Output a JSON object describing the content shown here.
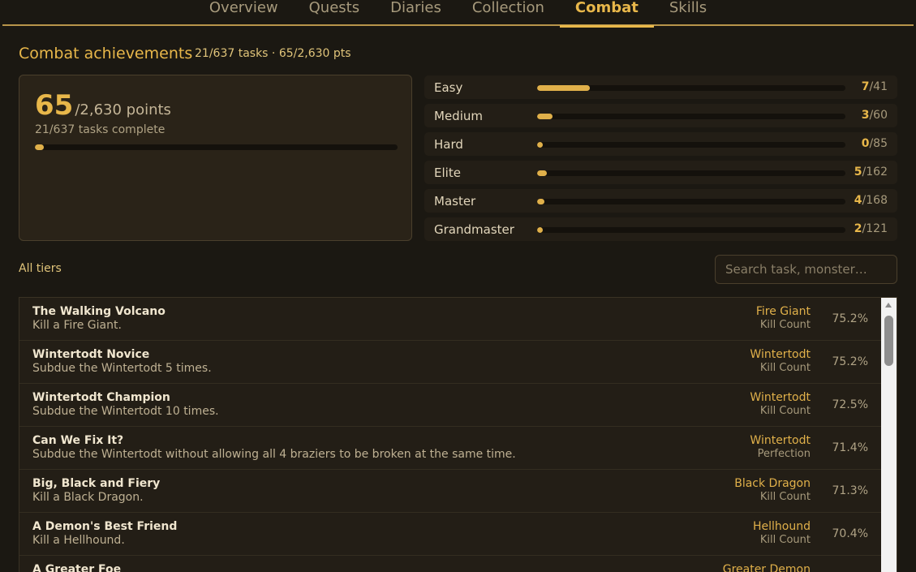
{
  "nav": {
    "tabs": [
      {
        "label": "Overview",
        "active": false
      },
      {
        "label": "Quests",
        "active": false
      },
      {
        "label": "Diaries",
        "active": false
      },
      {
        "label": "Collection",
        "active": false
      },
      {
        "label": "Combat",
        "active": true
      },
      {
        "label": "Skills",
        "active": false
      }
    ]
  },
  "header": {
    "title": "Combat achievements",
    "summary": "21/637 tasks · 65/2,630 pts"
  },
  "points": {
    "earned": "65",
    "total_label": "/2,630 points",
    "tasks_label": "21/637 tasks complete",
    "progress_fraction": 0.0247
  },
  "tiers": [
    {
      "name": "Easy",
      "done": "7",
      "total": "/41",
      "fraction": 0.171
    },
    {
      "name": "Medium",
      "done": "3",
      "total": "/60",
      "fraction": 0.05
    },
    {
      "name": "Hard",
      "done": "0",
      "total": "/85",
      "fraction": 0
    },
    {
      "name": "Elite",
      "done": "5",
      "total": "/162",
      "fraction": 0.031
    },
    {
      "name": "Master",
      "done": "4",
      "total": "/168",
      "fraction": 0.024
    },
    {
      "name": "Grandmaster",
      "done": "2",
      "total": "/121",
      "fraction": 0.017
    }
  ],
  "filter": {
    "tier_label": "All tiers",
    "search_placeholder": "Search task, monster…"
  },
  "tasks": [
    {
      "title": "The Walking Volcano",
      "desc": "Kill a Fire Giant.",
      "monster": "Fire Giant",
      "type": "Kill Count",
      "pct": "75.2%"
    },
    {
      "title": "Wintertodt Novice",
      "desc": "Subdue the Wintertodt 5 times.",
      "monster": "Wintertodt",
      "type": "Kill Count",
      "pct": "75.2%"
    },
    {
      "title": "Wintertodt Champion",
      "desc": "Subdue the Wintertodt 10 times.",
      "monster": "Wintertodt",
      "type": "Kill Count",
      "pct": "72.5%"
    },
    {
      "title": "Can We Fix It?",
      "desc": "Subdue the Wintertodt without allowing all 4 braziers to be broken at the same time.",
      "monster": "Wintertodt",
      "type": "Perfection",
      "pct": "71.4%"
    },
    {
      "title": "Big, Black and Fiery",
      "desc": "Kill a Black Dragon.",
      "monster": "Black Dragon",
      "type": "Kill Count",
      "pct": "71.3%"
    },
    {
      "title": "A Demon's Best Friend",
      "desc": "Kill a Hellhound.",
      "monster": "Hellhound",
      "type": "Kill Count",
      "pct": "70.4%"
    },
    {
      "title": "A Greater Foe",
      "desc": "",
      "monster": "Greater Demon",
      "type": "",
      "pct": ""
    }
  ]
}
